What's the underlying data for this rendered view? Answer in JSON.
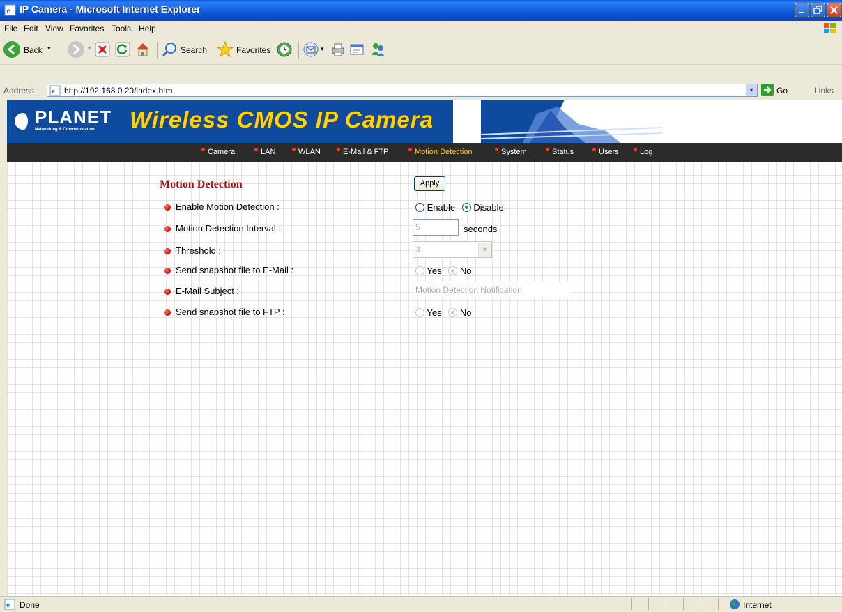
{
  "window": {
    "title": "IP Camera - Microsoft Internet Explorer"
  },
  "menu": [
    "File",
    "Edit",
    "View",
    "Favorites",
    "Tools",
    "Help"
  ],
  "toolbar": {
    "back_label": "Back",
    "search_label": "Search",
    "favorites_label": "Favorites"
  },
  "address": {
    "label": "Address",
    "url": "http://192.168.0.20/index.htm",
    "go_label": "Go",
    "links_label": "Links"
  },
  "banner": {
    "brand": "PLANET",
    "brand_sub": "Networking & Communication",
    "product_title": "Wireless CMOS IP Camera"
  },
  "nav": [
    {
      "label": "Camera",
      "active": false
    },
    {
      "label": "LAN",
      "active": false
    },
    {
      "label": "WLAN",
      "active": false
    },
    {
      "label": "E-Mail & FTP",
      "active": false
    },
    {
      "label": "Motion Detection",
      "active": true
    },
    {
      "label": "System",
      "active": false
    },
    {
      "label": "Status",
      "active": false
    },
    {
      "label": "Users",
      "active": false
    },
    {
      "label": "Log",
      "active": false
    }
  ],
  "form": {
    "title": "Motion Detection",
    "apply_label": "Apply",
    "rows": [
      {
        "label": "Enable Motion Detection :"
      },
      {
        "label": "Motion Detection Interval :"
      },
      {
        "label": "Threshold :"
      },
      {
        "label": "Send snapshot file to E-Mail :"
      },
      {
        "label": "E-Mail Subject :"
      },
      {
        "label": "Send snapshot file to FTP :"
      }
    ],
    "enable_opts": {
      "enable": "Enable",
      "disable": "Disable",
      "selected": "Disable"
    },
    "interval": {
      "value": "5",
      "unit": "seconds"
    },
    "threshold": {
      "value": "3"
    },
    "email_opts": {
      "yes": "Yes",
      "no": "No",
      "selected": "No"
    },
    "email_subject": {
      "value": "Motion Detection Notification"
    },
    "ftp_opts": {
      "yes": "Yes",
      "no": "No",
      "selected": "No"
    }
  },
  "status": {
    "left": "Done",
    "zone": "Internet"
  },
  "colors": {
    "titlebar": "#0a5bde",
    "nav_bg": "#2b2b2b",
    "nav_active": "#ffcc00",
    "section_title": "#a01515"
  }
}
